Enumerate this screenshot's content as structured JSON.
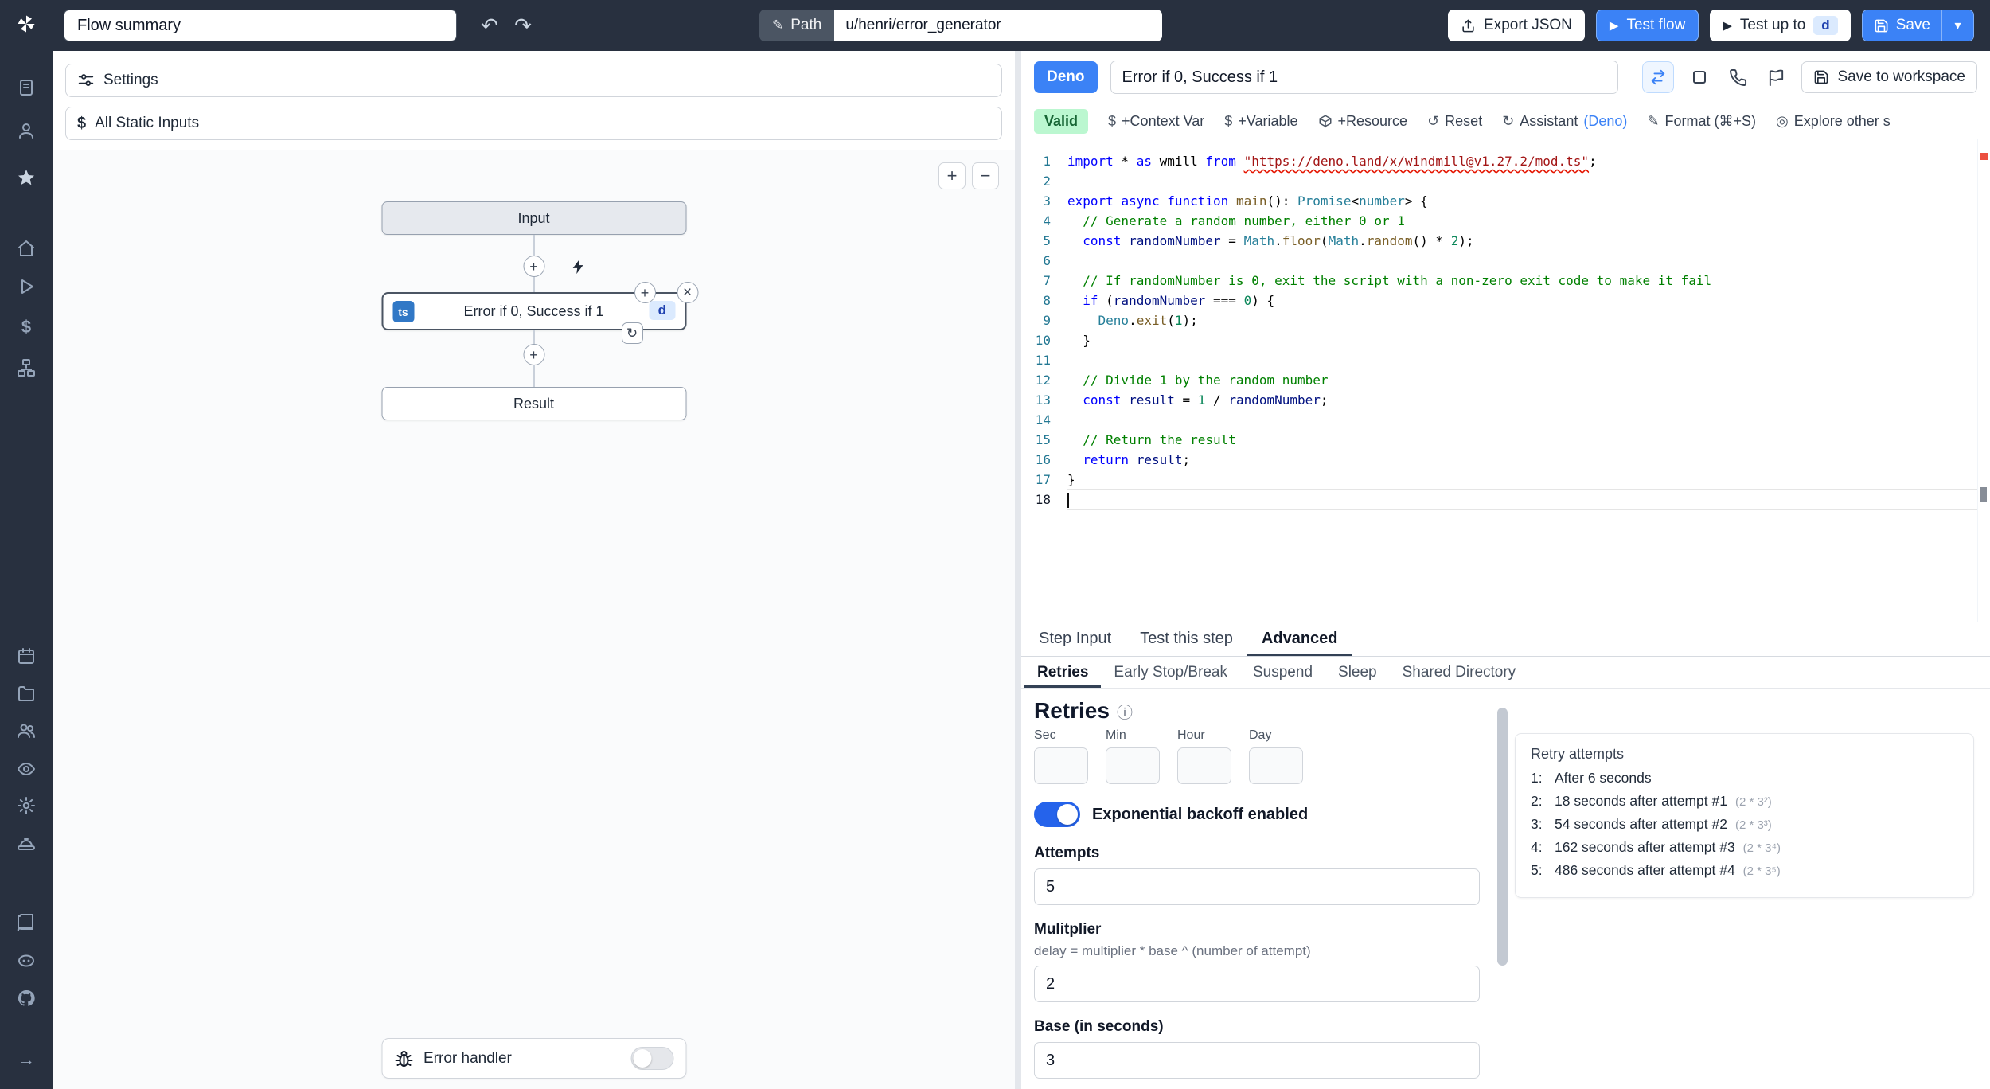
{
  "topbar": {
    "flow_summary": "Flow summary",
    "path_label": "Path",
    "path_value": "u/henri/error_generator",
    "export_json_label": "Export JSON",
    "test_flow_label": "Test flow",
    "test_up_to_label": "Test up to",
    "test_up_to_step_id": "d",
    "save_label": "Save"
  },
  "left_panel": {
    "settings_label": "Settings",
    "all_static_inputs_label": "All Static Inputs",
    "graph": {
      "input_node_label": "Input",
      "step_node_label": "Error if 0, Success if 1",
      "step_lang_badge": "ts",
      "step_id_badge": "d",
      "result_node_label": "Result",
      "error_handler_label": "Error handler"
    }
  },
  "right_panel": {
    "header": {
      "lang_badge": "Deno",
      "step_name": "Error if 0, Success if 1",
      "save_to_workspace_label": "Save to workspace"
    },
    "toolbar": {
      "valid_label": "Valid",
      "context_var_label": "+Context Var",
      "variable_label": "+Variable",
      "resource_label": "+Resource",
      "reset_label": "Reset",
      "assistant_label": "Assistant",
      "assistant_lang": "(Deno)",
      "format_label": "Format (⌘+S)",
      "explore_label": "Explore other s"
    },
    "tabs": [
      "Step Input",
      "Test this step",
      "Advanced"
    ],
    "active_tab": "Advanced",
    "subtabs": [
      "Retries",
      "Early Stop/Break",
      "Suspend",
      "Sleep",
      "Shared Directory"
    ],
    "active_subtab": "Retries",
    "editor": {
      "language": "typescript",
      "active_line": 18,
      "lines": [
        [
          [
            "import",
            "kw"
          ],
          [
            " * ",
            "pl"
          ],
          [
            "as",
            "kw"
          ],
          [
            " wmill ",
            "pl"
          ],
          [
            "from",
            "kw"
          ],
          [
            " ",
            "pl"
          ],
          [
            "\"https://deno.land/x/windmill@v1.27.2/mod.ts\"",
            "strerr"
          ],
          [
            ";",
            "pl"
          ]
        ],
        [],
        [
          [
            "export",
            "kw"
          ],
          [
            " ",
            "pl"
          ],
          [
            "async",
            "kw"
          ],
          [
            " ",
            "pl"
          ],
          [
            "function",
            "kw"
          ],
          [
            " ",
            "pl"
          ],
          [
            "main",
            "fn"
          ],
          [
            "(): ",
            "pl"
          ],
          [
            "Promise",
            "type"
          ],
          [
            "<",
            "pl"
          ],
          [
            "number",
            "type"
          ],
          [
            "> {",
            "pl"
          ]
        ],
        [
          [
            "  // Generate a random number, either 0 or 1",
            "cmt"
          ]
        ],
        [
          [
            "  ",
            "pl"
          ],
          [
            "const",
            "kw"
          ],
          [
            " ",
            "pl"
          ],
          [
            "randomNumber",
            "var"
          ],
          [
            " = ",
            "pl"
          ],
          [
            "Math",
            "type"
          ],
          [
            ".",
            "pl"
          ],
          [
            "floor",
            "fn"
          ],
          [
            "(",
            "pl"
          ],
          [
            "Math",
            "type"
          ],
          [
            ".",
            "pl"
          ],
          [
            "random",
            "fn"
          ],
          [
            "() * ",
            "pl"
          ],
          [
            "2",
            "num"
          ],
          [
            ");",
            "pl"
          ]
        ],
        [],
        [
          [
            "  // If randomNumber is 0, exit the script with a non-zero exit code to make it fail",
            "cmt"
          ]
        ],
        [
          [
            "  ",
            "pl"
          ],
          [
            "if",
            "kw"
          ],
          [
            " (",
            "pl"
          ],
          [
            "randomNumber",
            "var"
          ],
          [
            " === ",
            "pl"
          ],
          [
            "0",
            "num"
          ],
          [
            ") {",
            "pl"
          ]
        ],
        [
          [
            "    ",
            "pl"
          ],
          [
            "Deno",
            "type"
          ],
          [
            ".",
            "pl"
          ],
          [
            "exit",
            "fn"
          ],
          [
            "(",
            "pl"
          ],
          [
            "1",
            "num"
          ],
          [
            ");",
            "pl"
          ]
        ],
        [
          [
            "  }",
            "pl"
          ]
        ],
        [],
        [
          [
            "  // Divide 1 by the random number",
            "cmt"
          ]
        ],
        [
          [
            "  ",
            "pl"
          ],
          [
            "const",
            "kw"
          ],
          [
            " ",
            "pl"
          ],
          [
            "result",
            "var"
          ],
          [
            " = ",
            "pl"
          ],
          [
            "1",
            "num"
          ],
          [
            " / ",
            "pl"
          ],
          [
            "randomNumber",
            "var"
          ],
          [
            ";",
            "pl"
          ]
        ],
        [],
        [
          [
            "  // Return the result",
            "cmt"
          ]
        ],
        [
          [
            "  ",
            "pl"
          ],
          [
            "return",
            "kw"
          ],
          [
            " ",
            "pl"
          ],
          [
            "result",
            "var"
          ],
          [
            ";",
            "pl"
          ]
        ],
        [
          [
            "}",
            "pl"
          ]
        ],
        []
      ]
    },
    "retries": {
      "title": "Retries",
      "time_unit_labels": [
        "Sec",
        "Min",
        "Hour",
        "Day"
      ],
      "backoff_toggle_label": "Exponential backoff enabled",
      "backoff_enabled": true,
      "attempts_label": "Attempts",
      "attempts_value": "5",
      "multiplier_label": "Mulitplier",
      "multiplier_help": "delay = multiplier * base ^ (number of attempt)",
      "multiplier_value": "2",
      "base_label": "Base (in seconds)",
      "base_value": "3",
      "retry_attempts_title": "Retry attempts",
      "retry_attempts": [
        {
          "index": "1:",
          "text": "After 6 seconds",
          "formula": ""
        },
        {
          "index": "2:",
          "text": "18 seconds after attempt #1",
          "formula": "(2 * 3²)"
        },
        {
          "index": "3:",
          "text": "54 seconds after attempt #2",
          "formula": "(2 * 3³)"
        },
        {
          "index": "4:",
          "text": "162 seconds after attempt #3",
          "formula": "(2 * 3⁴)"
        },
        {
          "index": "5:",
          "text": "486 seconds after attempt #4",
          "formula": "(2 * 3⁵)"
        }
      ]
    }
  },
  "icons": {
    "undo": "↶",
    "redo": "↷",
    "pencil": "✎",
    "play": "▶",
    "chevron_down": "▾",
    "zoom_in": "+",
    "zoom_out": "−",
    "node_plus": "+",
    "node_close": "×",
    "node_retry": "↻",
    "dollar": "$",
    "reset": "↺",
    "assistant": "↻",
    "format": "✎",
    "explore": "◎",
    "info": "ⓘ"
  },
  "colors": {
    "topbar_bg": "#28303f",
    "accent_blue": "#3b82f6",
    "valid_bg": "#bbf7d0",
    "valid_text": "#166534",
    "ts_badge": "#3178c6",
    "step_id_bg": "#dbeafe"
  }
}
